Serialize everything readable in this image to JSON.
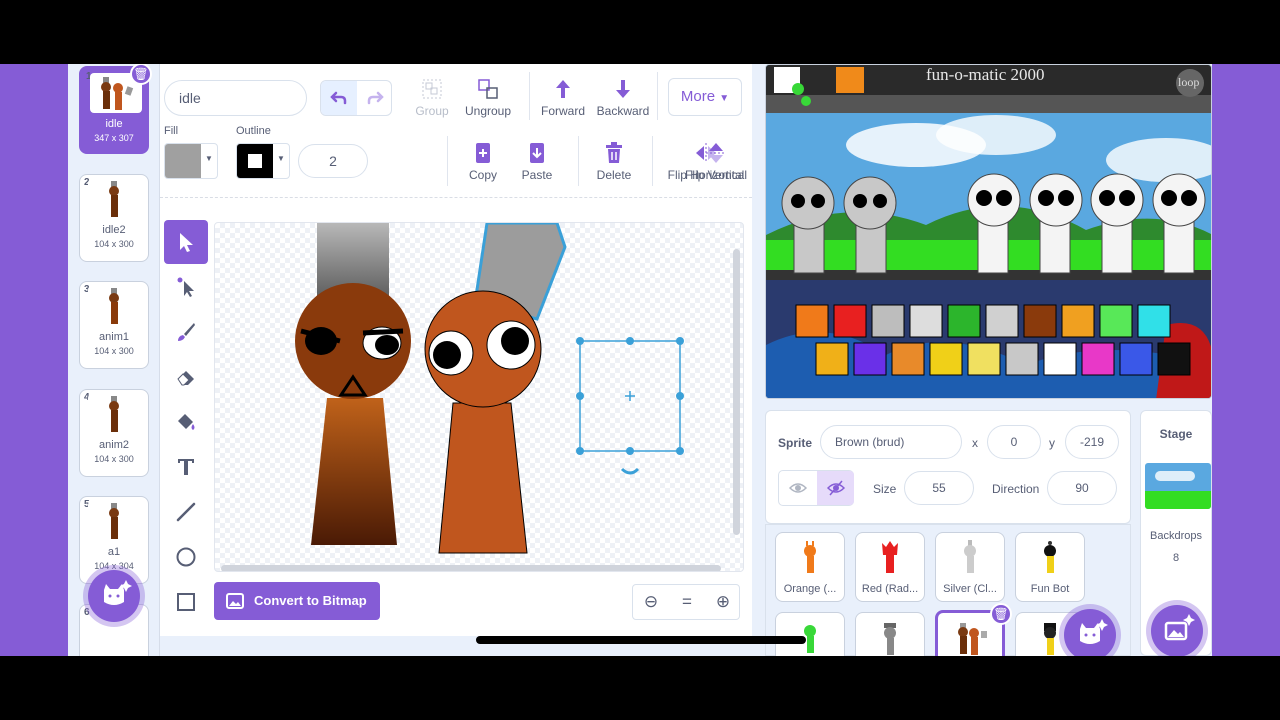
{
  "costumes": [
    {
      "num": "1",
      "name": "idle",
      "size": "347 x 307",
      "selected": true
    },
    {
      "num": "2",
      "name": "idle2",
      "size": "104 x 300"
    },
    {
      "num": "3",
      "name": "anim1",
      "size": "104 x 300"
    },
    {
      "num": "4",
      "name": "anim2",
      "size": "104 x 300"
    },
    {
      "num": "5",
      "name": "a1",
      "size": "104 x 304"
    },
    {
      "num": "6",
      "name": "",
      "size": ""
    }
  ],
  "editor": {
    "costume_name": "idle",
    "group_label": "Group",
    "ungroup_label": "Ungroup",
    "forward_label": "Forward",
    "backward_label": "Backward",
    "more_label": "More",
    "fill_label": "Fill",
    "outline_label": "Outline",
    "stroke_width": "2",
    "copy_label": "Copy",
    "paste_label": "Paste",
    "delete_label": "Delete",
    "flip_h_label": "Flip Horizontal",
    "flip_v_label": "Flip Vertical",
    "convert_label": "Convert to Bitmap",
    "zoom_reset": "="
  },
  "stage": {
    "title": "fun-o-matic 2000",
    "loop_label": "loop"
  },
  "sprite_info": {
    "sprite_label": "Sprite",
    "sprite_name": "Brown (brud)",
    "x_label": "x",
    "x": "0",
    "y_label": "y",
    "y": "-219",
    "size_label": "Size",
    "size": "55",
    "direction_label": "Direction",
    "direction": "90"
  },
  "sprites": [
    {
      "name": "Orange (..."
    },
    {
      "name": "Red (Rad..."
    },
    {
      "name": "Silver (Cl..."
    },
    {
      "name": "Fun Bot"
    }
  ],
  "stage_pane": {
    "label": "Stage",
    "backdrops_label": "Backdrops",
    "backdrops_count": "8"
  },
  "colors": {
    "accent": "#855cd6",
    "text": "#575e75",
    "fill_color": "#a0a0a0",
    "outline_color": "#000000"
  }
}
